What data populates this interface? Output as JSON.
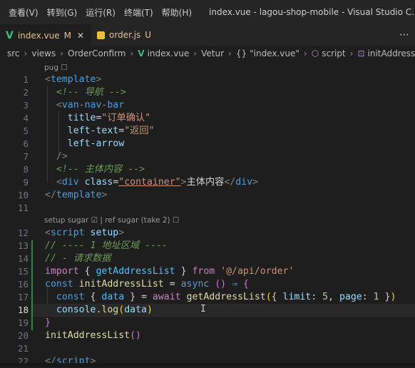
{
  "menu": [
    "查看(V)",
    "转到(G)",
    "运行(R)",
    "终端(T)",
    "帮助(H)"
  ],
  "window_title": "index.vue - lagou-shop-mobile - Visual Studio C...",
  "tabs": [
    {
      "name": "index.vue",
      "status": "M"
    },
    {
      "name": "order.js",
      "status": "U"
    }
  ],
  "breadcrumb": [
    "src",
    "views",
    "OrderConfirm",
    "index.vue",
    "Vetur",
    "\"index.vue\"",
    "script",
    "initAddressList"
  ],
  "codelens": {
    "pug": "pug ☐",
    "setup": "setup sugar ☑ | ref sugar (take 2) ☐"
  },
  "line_numbers": [
    "1",
    "2",
    "3",
    "4",
    "5",
    "6",
    "7",
    "8",
    "9",
    "10",
    "11",
    "12",
    "13",
    "14",
    "15",
    "16",
    "17",
    "18",
    "19",
    "20",
    "21",
    "22"
  ],
  "current_line": "18",
  "code": [
    [
      [
        "t-bracket",
        "<"
      ],
      [
        "t-tag",
        "template"
      ],
      [
        "t-bracket",
        ">"
      ]
    ],
    [
      [
        "t-cmt",
        "  <!-- 导航 -->"
      ]
    ],
    [
      [
        "t-plain",
        "  "
      ],
      [
        "t-bracket",
        "<"
      ],
      [
        "t-tag",
        "van-nav-bar"
      ]
    ],
    [
      [
        "t-plain",
        "    "
      ],
      [
        "t-attr",
        "title"
      ],
      [
        "t-plain",
        "="
      ],
      [
        "t-str",
        "\"订单确认\""
      ]
    ],
    [
      [
        "t-plain",
        "    "
      ],
      [
        "t-attr",
        "left-text"
      ],
      [
        "t-plain",
        "="
      ],
      [
        "t-str",
        "\"返回\""
      ]
    ],
    [
      [
        "t-plain",
        "    "
      ],
      [
        "t-attr",
        "left-arrow"
      ]
    ],
    [
      [
        "t-plain",
        "  "
      ],
      [
        "t-bracket",
        "/>"
      ]
    ],
    [
      [
        "t-cmt",
        "  <!-- 主体内容 -->"
      ]
    ],
    [
      [
        "t-plain",
        "  "
      ],
      [
        "t-bracket",
        "<"
      ],
      [
        "t-tag",
        "div"
      ],
      [
        "t-plain",
        " "
      ],
      [
        "t-attr",
        "class"
      ],
      [
        "t-plain",
        "="
      ],
      [
        "t-str t-ul",
        "\"container\""
      ],
      [
        "t-bracket",
        ">"
      ],
      [
        "t-textc",
        "主体内容"
      ],
      [
        "t-bracket",
        "</"
      ],
      [
        "t-tag",
        "div"
      ],
      [
        "t-bracket",
        ">"
      ]
    ],
    [
      [
        "t-bracket",
        "</"
      ],
      [
        "t-tag",
        "template"
      ],
      [
        "t-bracket",
        ">"
      ]
    ],
    [],
    [
      [
        "t-bracket",
        "<"
      ],
      [
        "t-tag",
        "script"
      ],
      [
        "t-plain",
        " "
      ],
      [
        "t-attr",
        "setup"
      ],
      [
        "t-bracket",
        ">"
      ]
    ],
    [
      [
        "t-cmt",
        "// ---- 1 地址区域 ----"
      ]
    ],
    [
      [
        "t-cmt",
        "// - 请求数据"
      ]
    ],
    [
      [
        "t-kw",
        "import"
      ],
      [
        "t-plain",
        " { "
      ],
      [
        "t-var",
        "getAddressList"
      ],
      [
        "t-plain",
        " } "
      ],
      [
        "t-kw",
        "from"
      ],
      [
        "t-plain",
        " "
      ],
      [
        "t-str",
        "'@/api/order'"
      ]
    ],
    [
      [
        "t-kw2",
        "const"
      ],
      [
        "t-plain",
        " "
      ],
      [
        "t-fn",
        "initAddressList"
      ],
      [
        "t-plain",
        " = "
      ],
      [
        "t-kw2",
        "async"
      ],
      [
        "t-plain",
        " "
      ],
      [
        "t-paren",
        "()"
      ],
      [
        "t-plain",
        " "
      ],
      [
        "t-kw2",
        "⇒"
      ],
      [
        "t-plain",
        " "
      ],
      [
        "t-paren",
        "{"
      ]
    ],
    [
      [
        "t-plain",
        "  "
      ],
      [
        "t-kw2",
        "const"
      ],
      [
        "t-plain",
        " { "
      ],
      [
        "t-var",
        "data"
      ],
      [
        "t-plain",
        " } = "
      ],
      [
        "t-kw",
        "await"
      ],
      [
        "t-plain",
        " "
      ],
      [
        "t-fn",
        "getAddressList"
      ],
      [
        "t-brace",
        "("
      ],
      [
        "t-plain",
        "{ "
      ],
      [
        "t-attr",
        "limit"
      ],
      [
        "t-plain",
        ": "
      ],
      [
        "t-num",
        "5"
      ],
      [
        "t-plain",
        ", "
      ],
      [
        "t-attr",
        "page"
      ],
      [
        "t-plain",
        ": "
      ],
      [
        "t-num",
        "1"
      ],
      [
        "t-plain",
        " }"
      ],
      [
        "t-brace",
        ")"
      ]
    ],
    [
      [
        "t-plain",
        "  "
      ],
      [
        "t-attr",
        "console"
      ],
      [
        "t-plain",
        "."
      ],
      [
        "t-fn",
        "log"
      ],
      [
        "t-brace",
        "("
      ],
      [
        "t-attr",
        "data"
      ],
      [
        "t-brace",
        ")"
      ]
    ],
    [
      [
        "t-paren",
        "}"
      ]
    ],
    [
      [
        "t-fn",
        "initAddressList"
      ],
      [
        "t-paren",
        "()"
      ]
    ],
    [],
    [
      [
        "t-bracket",
        "</"
      ],
      [
        "t-tag",
        "script"
      ],
      [
        "t-bracket",
        ">"
      ]
    ]
  ]
}
